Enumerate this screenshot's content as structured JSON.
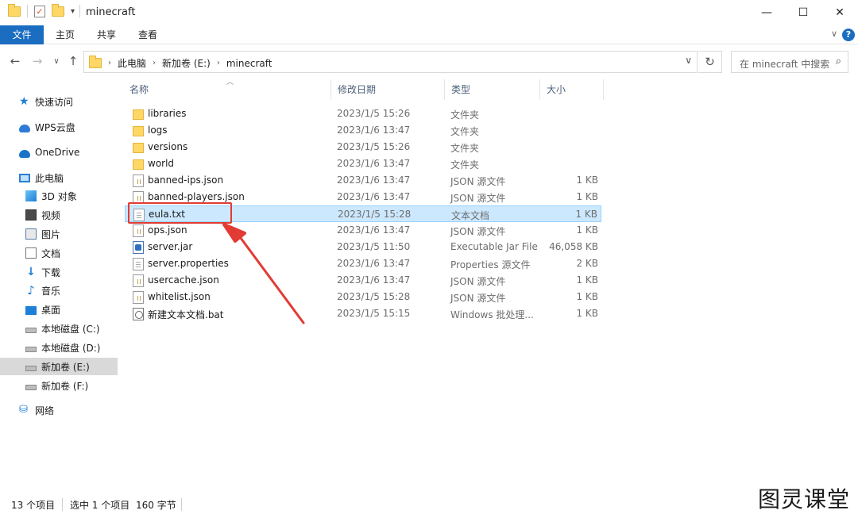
{
  "window": {
    "title": "minecraft",
    "minimize_glyph": "—",
    "maximize_glyph": "☐",
    "close_glyph": "✕"
  },
  "ribbon": {
    "tabs": [
      "文件",
      "主页",
      "共享",
      "查看"
    ],
    "help_glyph": "?",
    "collapse_glyph": "∨"
  },
  "address": {
    "crumbs": [
      "此电脑",
      "新加卷 (E:)",
      "minecraft"
    ],
    "search_placeholder": "在 minecraft 中搜索"
  },
  "sidebar": {
    "items": [
      {
        "label": "快速访问",
        "icon": "star-icon"
      },
      {
        "label": "WPS云盘",
        "icon": "cloud-icon"
      },
      {
        "label": "OneDrive",
        "icon": "onedrive-icon"
      },
      {
        "label": "此电脑",
        "icon": "computer-icon"
      },
      {
        "label": "3D 对象",
        "icon": "cube-icon"
      },
      {
        "label": "视频",
        "icon": "video-icon"
      },
      {
        "label": "图片",
        "icon": "picture-icon"
      },
      {
        "label": "文档",
        "icon": "document-icon"
      },
      {
        "label": "下载",
        "icon": "download-icon"
      },
      {
        "label": "音乐",
        "icon": "music-icon"
      },
      {
        "label": "桌面",
        "icon": "desktop-icon"
      },
      {
        "label": "本地磁盘 (C:)",
        "icon": "drive-icon"
      },
      {
        "label": "本地磁盘 (D:)",
        "icon": "drive-icon"
      },
      {
        "label": "新加卷 (E:)",
        "icon": "drive-icon"
      },
      {
        "label": "新加卷 (F:)",
        "icon": "drive-icon"
      },
      {
        "label": "网络",
        "icon": "network-icon"
      }
    ],
    "selected": "新加卷 (E:)"
  },
  "filelist": {
    "columns": [
      "名称",
      "修改日期",
      "类型",
      "大小"
    ],
    "rows": [
      {
        "name": "libraries",
        "date": "2023/1/5 15:26",
        "type": "文件夹",
        "size": "",
        "icon": "folder"
      },
      {
        "name": "logs",
        "date": "2023/1/6 13:47",
        "type": "文件夹",
        "size": "",
        "icon": "folder"
      },
      {
        "name": "versions",
        "date": "2023/1/5 15:26",
        "type": "文件夹",
        "size": "",
        "icon": "folder"
      },
      {
        "name": "world",
        "date": "2023/1/6 13:47",
        "type": "文件夹",
        "size": "",
        "icon": "folder"
      },
      {
        "name": "banned-ips.json",
        "date": "2023/1/6 13:47",
        "type": "JSON 源文件",
        "size": "1 KB",
        "icon": "json"
      },
      {
        "name": "banned-players.json",
        "date": "2023/1/6 13:47",
        "type": "JSON 源文件",
        "size": "1 KB",
        "icon": "json"
      },
      {
        "name": "eula.txt",
        "date": "2023/1/5 15:28",
        "type": "文本文档",
        "size": "1 KB",
        "icon": "doc"
      },
      {
        "name": "ops.json",
        "date": "2023/1/6 13:47",
        "type": "JSON 源文件",
        "size": "1 KB",
        "icon": "json"
      },
      {
        "name": "server.jar",
        "date": "2023/1/5 11:50",
        "type": "Executable Jar File",
        "size": "46,058 KB",
        "icon": "jar"
      },
      {
        "name": "server.properties",
        "date": "2023/1/6 13:47",
        "type": "Properties 源文件",
        "size": "2 KB",
        "icon": "doc"
      },
      {
        "name": "usercache.json",
        "date": "2023/1/6 13:47",
        "type": "JSON 源文件",
        "size": "1 KB",
        "icon": "json"
      },
      {
        "name": "whitelist.json",
        "date": "2023/1/5 15:28",
        "type": "JSON 源文件",
        "size": "1 KB",
        "icon": "json"
      },
      {
        "name": "新建文本文档.bat",
        "date": "2023/1/5 15:15",
        "type": "Windows 批处理...",
        "size": "1 KB",
        "icon": "bat"
      }
    ],
    "selected": "eula.txt"
  },
  "status": {
    "count": "13 个项目",
    "selection": "选中 1 个项目",
    "size": "160 字节"
  },
  "watermark": "图灵课堂",
  "colors": {
    "accent": "#1a6dc0",
    "selection": "#cce8ff",
    "annotation": "#e23b33"
  }
}
